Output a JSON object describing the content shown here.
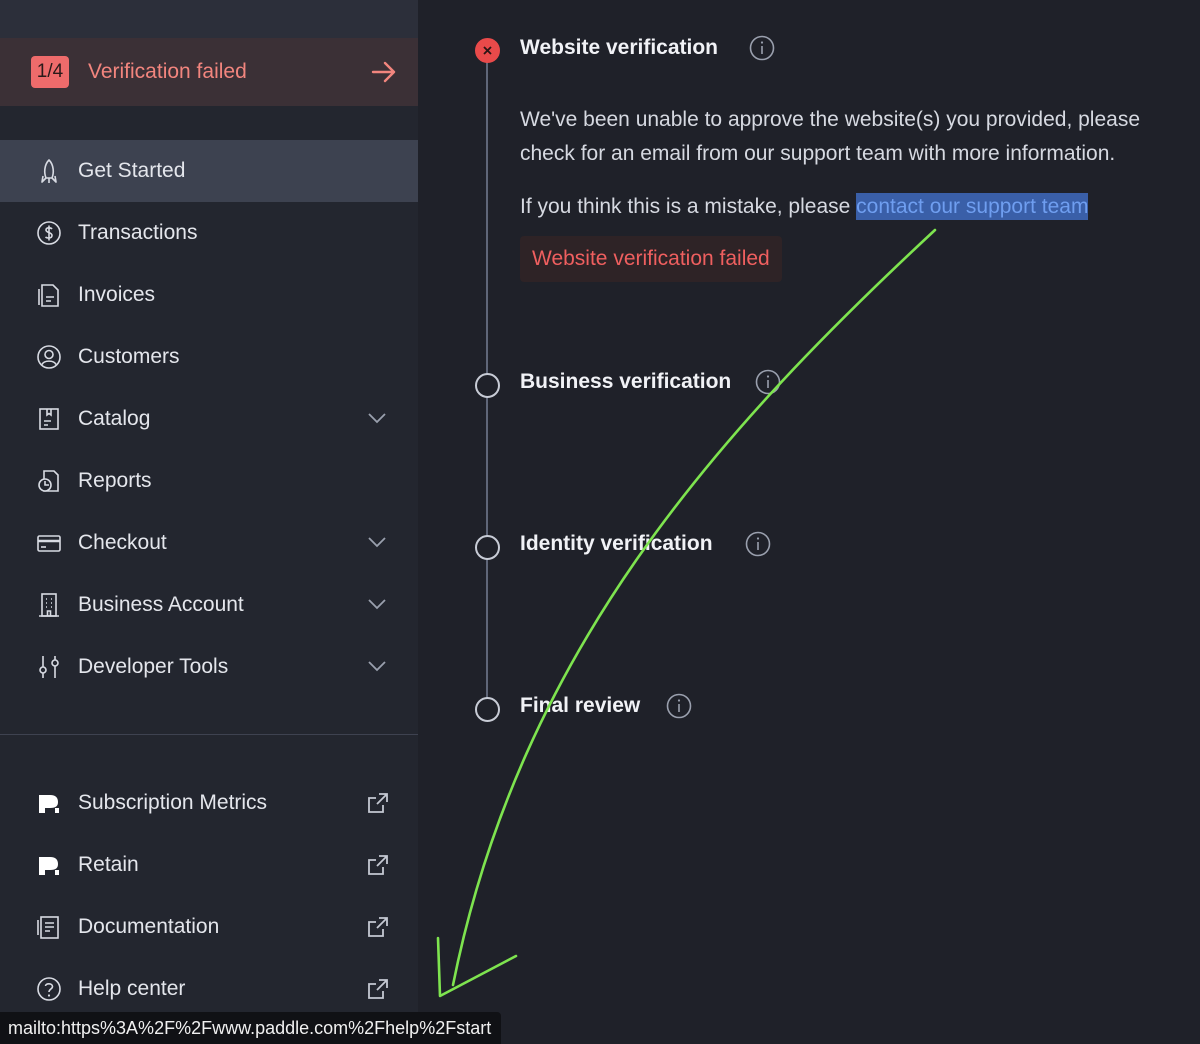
{
  "status": {
    "step": "1/4",
    "label": "Verification failed",
    "color": "#ee6b6b"
  },
  "sidebar": {
    "items": [
      {
        "label": "Get Started",
        "icon": "rocket-icon",
        "active": true
      },
      {
        "label": "Transactions",
        "icon": "dollar-circle-icon"
      },
      {
        "label": "Invoices",
        "icon": "invoice-icon"
      },
      {
        "label": "Customers",
        "icon": "user-circle-icon"
      },
      {
        "label": "Catalog",
        "icon": "catalog-icon",
        "expandable": true
      },
      {
        "label": "Reports",
        "icon": "reports-icon"
      },
      {
        "label": "Checkout",
        "icon": "credit-card-icon",
        "expandable": true
      },
      {
        "label": "Business Account",
        "icon": "building-icon",
        "expandable": true
      },
      {
        "label": "Developer Tools",
        "icon": "sliders-icon",
        "expandable": true
      }
    ],
    "external": [
      {
        "label": "Subscription Metrics",
        "icon": "paddle-logo-icon"
      },
      {
        "label": "Retain",
        "icon": "paddle-logo-icon"
      },
      {
        "label": "Documentation",
        "icon": "document-icon"
      },
      {
        "label": "Help center",
        "icon": "help-circle-icon"
      }
    ]
  },
  "steps": [
    {
      "title": "Website verification",
      "state": "failed"
    },
    {
      "title": "Business verification",
      "state": "pending"
    },
    {
      "title": "Identity verification",
      "state": "pending"
    },
    {
      "title": "Final review",
      "state": "pending"
    }
  ],
  "website_step": {
    "message": "We've been unable to approve the website(s) you provided, please check for an email from our support team with more information.",
    "mistake_prefix": "If you think this is a mistake, please ",
    "link_text": "contact our support team",
    "badge": "Website verification failed"
  },
  "status_url": "mailto:https%3A%2F%2Fwww.paddle.com%2Fhelp%2Fstart",
  "colors": {
    "annotation_arrow": "#7ee44f",
    "link": "#6f9ef0",
    "error": "#ef5f5f"
  }
}
